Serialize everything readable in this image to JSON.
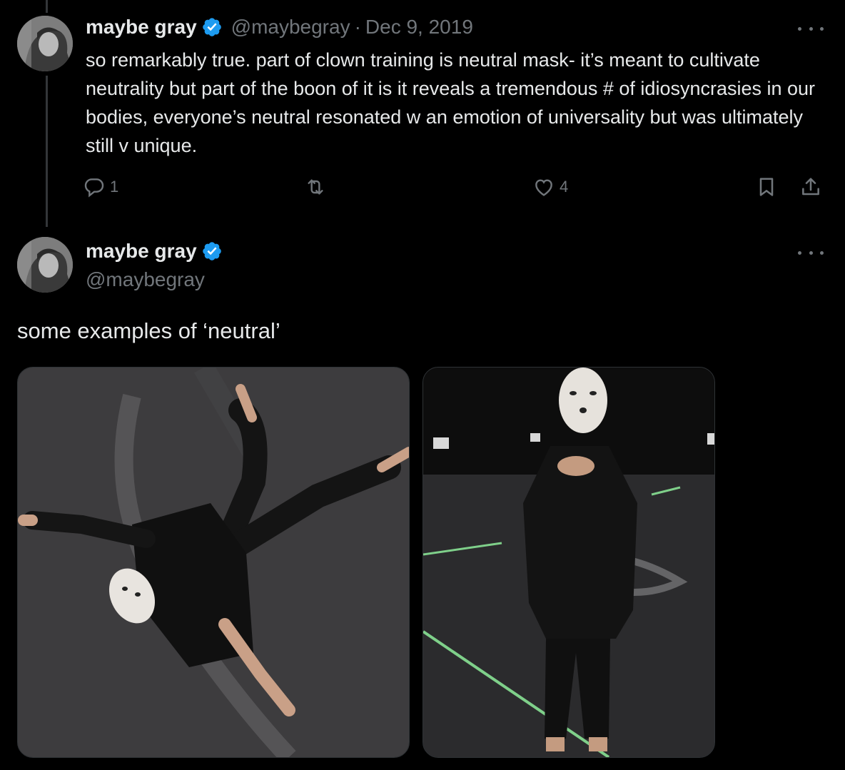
{
  "parent_tweet": {
    "author_name": "maybe gray",
    "handle": "@maybegray",
    "separator": "·",
    "date": "Dec 9, 2019",
    "text": "so remarkably true. part of clown training is neutral mask- it’s meant to cultivate neutrality but part of the boon of it is it reveals a tremendous # of idiosyncrasies in our bodies, everyone’s neutral resonated w an emotion of universality but was ultimately still v unique.",
    "reply_count": "1",
    "retweet_count": "",
    "like_count": "4"
  },
  "main_tweet": {
    "author_name": "maybe gray",
    "handle": "@maybegray",
    "text": "some examples of ‘neutral’"
  },
  "icons": {
    "verified": "verified-badge-icon",
    "more": "more-options-icon",
    "reply": "reply-icon",
    "retweet": "retweet-icon",
    "like": "heart-icon",
    "bookmark": "bookmark-icon",
    "share": "share-icon"
  },
  "colors": {
    "background": "#000000",
    "text": "#e7e9ea",
    "muted": "#71767b",
    "verified": "#1d9bf0",
    "thread_line": "#333639"
  }
}
